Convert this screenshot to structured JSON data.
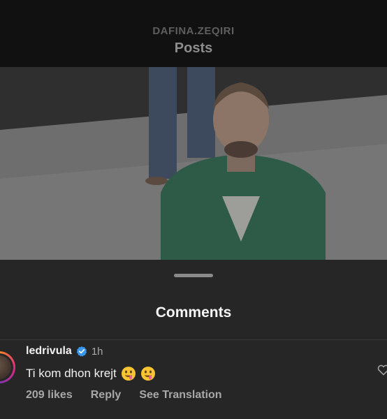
{
  "header": {
    "account": "DAFINA.ZEQIRI",
    "title": "Posts"
  },
  "sheet": {
    "title": "Comments"
  },
  "comment": {
    "username": "ledrivula",
    "verified": true,
    "time": "1h",
    "text": "Ti kom dhon krejt",
    "emojis": [
      "drooling-face-emoji",
      "drooling-face-emoji"
    ],
    "likes": "209 likes",
    "reply": "Reply",
    "see_translation": "See Translation"
  },
  "colors": {
    "sheet_bg": "#262626",
    "verified_blue": "#3897f0",
    "secondary_text": "#a8a8a8"
  }
}
